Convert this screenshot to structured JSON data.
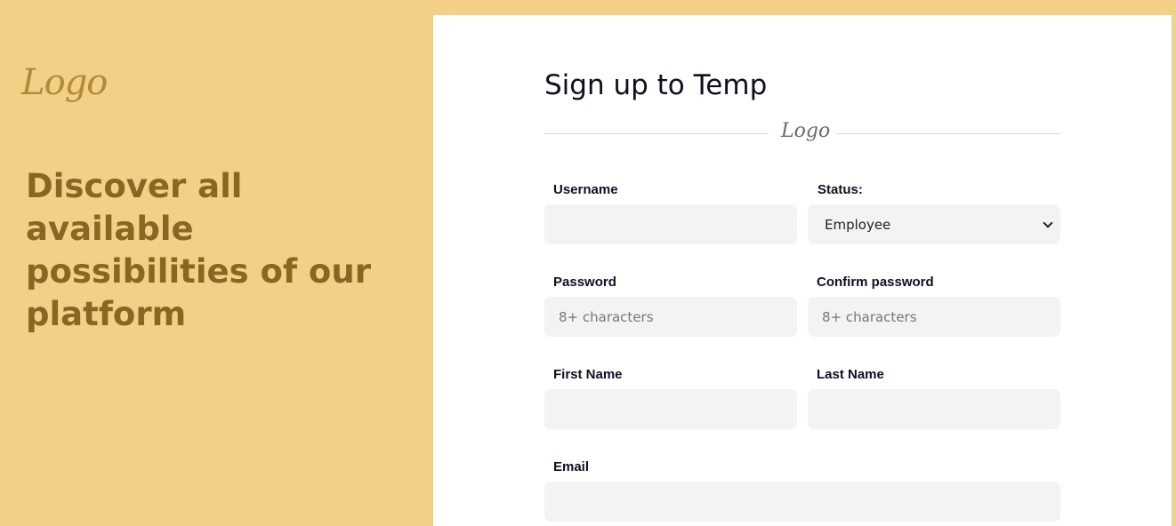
{
  "left": {
    "logo": "Logo",
    "headline": "Discover all available possibilities of our platform"
  },
  "form": {
    "title": "Sign up to Temp",
    "divider_logo": "Logo",
    "username": {
      "label": "Username",
      "value": "",
      "placeholder": ""
    },
    "status": {
      "label": "Status:",
      "selected": "Employee"
    },
    "password": {
      "label": "Password",
      "value": "",
      "placeholder": "8+ characters"
    },
    "confirm_password": {
      "label": "Confirm password",
      "value": "",
      "placeholder": "8+ characters"
    },
    "first_name": {
      "label": "First Name",
      "value": "",
      "placeholder": ""
    },
    "last_name": {
      "label": "Last Name",
      "value": "",
      "placeholder": ""
    },
    "email": {
      "label": "Email",
      "value": "",
      "placeholder": ""
    }
  },
  "colors": {
    "background": "#f2d086",
    "headline": "#8c6522",
    "logo": "#b38a3a",
    "input_bg": "#f3f3f3",
    "card": "#ffffff"
  },
  "icons": {
    "status_dropdown": "chevron-down-icon"
  }
}
